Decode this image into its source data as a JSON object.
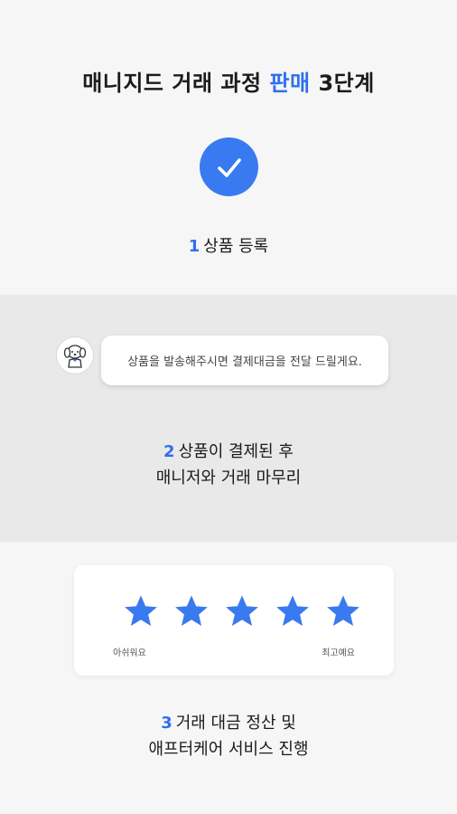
{
  "header": {
    "title_prefix": "매니지드 거래 과정",
    "title_highlight": "판매",
    "title_suffix": "3단계"
  },
  "step1": {
    "number": "1",
    "label": "상품 등록"
  },
  "chat": {
    "message": "상품을 발송해주시면 결제대금을 전달 드릴게요."
  },
  "step2": {
    "number": "2",
    "line1": "상품이 결제된 후",
    "line2": "매니저와 거래 마무리"
  },
  "rating": {
    "stars_filled": 5,
    "stars_total": 5,
    "low_label": "아쉬워요",
    "high_label": "최고예요"
  },
  "step3": {
    "number": "3",
    "line1": "거래 대금 정산 및",
    "line2": "애프터케어 서비스 진행"
  },
  "colors": {
    "accent": "#3a7af0",
    "text": "#1b1b1b",
    "band": "#e9e9e9",
    "background": "#f6f6f6"
  }
}
